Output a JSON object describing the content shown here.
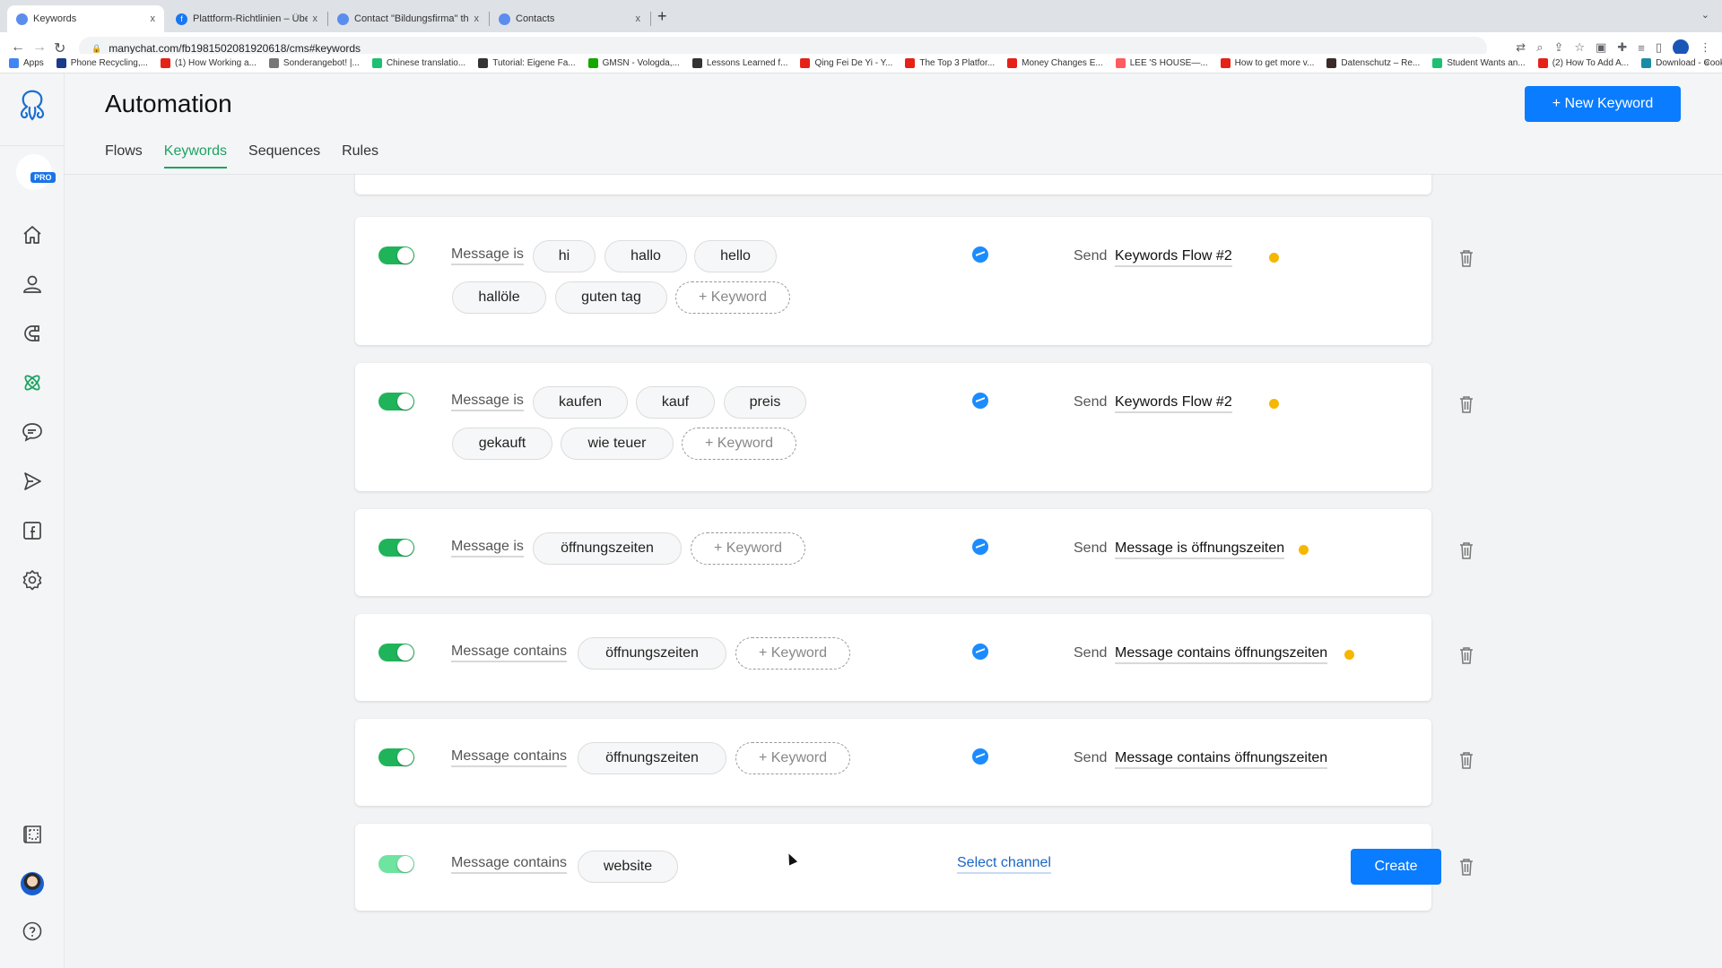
{
  "browser": {
    "tabs": [
      {
        "title": "Keywords",
        "active": true,
        "icon": "manychat-icon"
      },
      {
        "title": "Plattform-Richtlinien – Übersic",
        "active": false,
        "icon": "facebook-icon"
      },
      {
        "title": "Contact \"Bildungsfirma\" throu",
        "active": false,
        "icon": "manychat-icon"
      },
      {
        "title": "Contacts",
        "active": false,
        "icon": "manychat-icon"
      }
    ],
    "close_glyph": "x",
    "new_tab_glyph": "+",
    "url": "manychat.com/fb198150208192061​8/cms#keywords",
    "bookmarks": [
      {
        "label": "Apps",
        "icon": "apps-grid-icon",
        "color": "#4285f4"
      },
      {
        "label": "Phone Recycling,...",
        "icon": "o2-icon",
        "color": "#1a3a8a"
      },
      {
        "label": "(1) How Working a...",
        "icon": "youtube-icon",
        "color": "#e62117"
      },
      {
        "label": "Sonderangebot! |...",
        "icon": "checkmark-icon",
        "color": "#777777"
      },
      {
        "label": "Chinese translatio...",
        "icon": "fiverr-icon",
        "color": "#1dbf73"
      },
      {
        "label": "Tutorial: Eigene Fa...",
        "icon": "hashtag-icon",
        "color": "#333333"
      },
      {
        "label": "GMSN - Vologda,...",
        "icon": "upwork-icon",
        "color": "#14a800"
      },
      {
        "label": "Lessons Learned f...",
        "icon": "er-icon",
        "color": "#333333"
      },
      {
        "label": "Qing Fei De Yi - Y...",
        "icon": "youtube-icon",
        "color": "#e62117"
      },
      {
        "label": "The Top 3 Platfor...",
        "icon": "youtube-icon",
        "color": "#e62117"
      },
      {
        "label": "Money Changes E...",
        "icon": "youtube-icon",
        "color": "#e62117"
      },
      {
        "label": "LEE 'S HOUSE—...",
        "icon": "airbnb-icon",
        "color": "#ff5a5f"
      },
      {
        "label": "How to get more v...",
        "icon": "youtube-icon",
        "color": "#e62117"
      },
      {
        "label": "Datenschutz – Re...",
        "icon": "site-icon",
        "color": "#3a2a2a"
      },
      {
        "label": "Student Wants an...",
        "icon": "t-icon",
        "color": "#1dbf73"
      },
      {
        "label": "(2) How To Add A...",
        "icon": "youtube-icon",
        "color": "#e62117"
      },
      {
        "label": "Download - Cooki...",
        "icon": "cookie-icon",
        "color": "#1a8ca3"
      }
    ],
    "bookmarks_more": "»"
  },
  "sidebar": {
    "pro_badge": "PRO",
    "items": [
      {
        "name": "home",
        "icon": "home-icon",
        "active": false
      },
      {
        "name": "contacts",
        "icon": "user-icon",
        "active": false
      },
      {
        "name": "growth-tools",
        "icon": "magnet-icon",
        "active": false
      },
      {
        "name": "automation",
        "icon": "atom-icon",
        "active": true
      },
      {
        "name": "live-chat",
        "icon": "chat-icon",
        "active": false
      },
      {
        "name": "broadcasting",
        "icon": "send-icon",
        "active": false
      },
      {
        "name": "facebook-ads",
        "icon": "facebook-square-icon",
        "active": false
      },
      {
        "name": "settings",
        "icon": "gear-icon",
        "active": false
      }
    ],
    "bottom_items": [
      {
        "name": "templates",
        "icon": "templates-icon"
      },
      {
        "name": "profile",
        "icon": "avatar"
      },
      {
        "name": "help",
        "icon": "help-circle-icon"
      }
    ]
  },
  "header": {
    "title": "Automation",
    "new_keyword_label": "+ New Keyword",
    "tabs": [
      {
        "label": "Flows",
        "active": false
      },
      {
        "label": "Keywords",
        "active": true
      },
      {
        "label": "Sequences",
        "active": false
      },
      {
        "label": "Rules",
        "active": false
      }
    ]
  },
  "rules": [
    {
      "enabled": true,
      "condition": "Message is",
      "keywords": [
        "hi",
        "hallo",
        "hello",
        "hallöle",
        "guten tag"
      ],
      "add_keyword_label": "+ Keyword",
      "channel": "messenger",
      "send_label": "Send",
      "flow": "Keywords Flow #2",
      "flow_status_dot": true
    },
    {
      "enabled": true,
      "condition": "Message is",
      "keywords": [
        "kaufen",
        "kauf",
        "preis",
        "gekauft",
        "wie teuer"
      ],
      "add_keyword_label": "+ Keyword",
      "channel": "messenger",
      "send_label": "Send",
      "flow": "Keywords Flow #2",
      "flow_status_dot": true
    },
    {
      "enabled": true,
      "condition": "Message is",
      "keywords": [
        "öffnungszeiten"
      ],
      "add_keyword_label": "+ Keyword",
      "channel": "messenger",
      "send_label": "Send",
      "flow": "Message is öffnungszeiten",
      "flow_status_dot": true
    },
    {
      "enabled": true,
      "condition": "Message contains",
      "keywords": [
        "öffnungszeiten"
      ],
      "add_keyword_label": "+ Keyword",
      "channel": "messenger",
      "send_label": "Send",
      "flow": "Message contains öffnungszeiten",
      "flow_status_dot": true
    },
    {
      "enabled": true,
      "condition": "Message contains",
      "keywords": [
        "öffnungszeiten"
      ],
      "add_keyword_label": "+ Keyword",
      "channel": "messenger",
      "send_label": "Send",
      "flow": "Message contains öffnungszeiten",
      "flow_status_dot": false
    }
  ],
  "draft_rule": {
    "enabled": true,
    "condition": "Message contains",
    "keyword": "website",
    "select_channel_label": "Select channel",
    "create_label": "Create"
  },
  "colors": {
    "accent_green": "#1ea362",
    "primary_blue": "#0a7cff",
    "status_yellow": "#f5b700",
    "messenger_blue": "#1a8cff"
  }
}
